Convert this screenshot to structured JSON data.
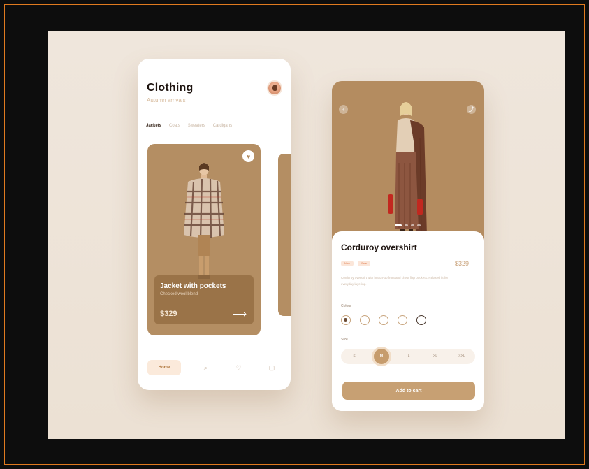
{
  "catalog": {
    "title": "Clothing",
    "subtitle": "Autumn arrivals",
    "categories": [
      "Jackets",
      "Coats",
      "Sweaters",
      "Cardigans"
    ],
    "featured": {
      "name": "Jacket with pockets",
      "subtitle": "Checked wool blend",
      "price": "$329"
    },
    "nav": {
      "home": "Home",
      "icons": [
        "search-icon",
        "heart-icon",
        "bag-icon"
      ]
    }
  },
  "product": {
    "title": "Corduroy overshirt",
    "tags": [
      "New",
      "Sale"
    ],
    "price": "$329",
    "description": "Corduroy overshirt with button-up front and chest flap pockets. Relaxed fit for everyday layering.",
    "color_label": "Colour",
    "size_label": "Size",
    "colors": [
      {
        "name": "brown",
        "selected": true
      },
      {
        "name": "cream",
        "selected": false
      },
      {
        "name": "white",
        "selected": false
      },
      {
        "name": "beige",
        "selected": false
      },
      {
        "name": "dark",
        "selected": false
      }
    ],
    "sizes": [
      "S",
      "M",
      "L",
      "XL",
      "XXL"
    ],
    "selected_size": "M",
    "add_to_cart": "Add to cart"
  },
  "colors": {
    "accent": "#c7a073",
    "card": "#b48e63",
    "frame": "#e07a1f"
  }
}
